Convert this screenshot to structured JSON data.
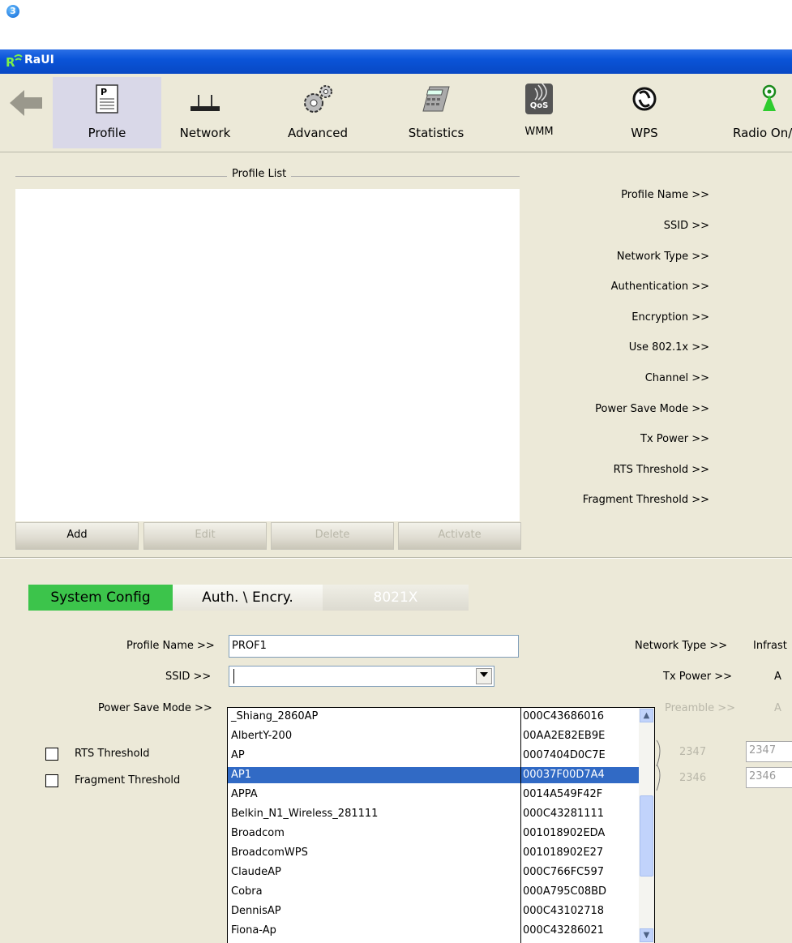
{
  "step_badge": "3",
  "window": {
    "title": "RaUI"
  },
  "toolbar": {
    "items": [
      {
        "label": "Profile",
        "icon": "profile-icon"
      },
      {
        "label": "Network",
        "icon": "network-icon"
      },
      {
        "label": "Advanced",
        "icon": "advanced-icon"
      },
      {
        "label": "Statistics",
        "icon": "statistics-icon"
      },
      {
        "label": "WMM",
        "icon": "wmm-icon"
      },
      {
        "label": "WPS",
        "icon": "wps-icon"
      },
      {
        "label": "Radio On/",
        "icon": "radio-icon"
      }
    ],
    "wmm_badge": "QoS"
  },
  "profile_list": {
    "title": "Profile List",
    "buttons": {
      "add": "Add",
      "edit": "Edit",
      "delete": "Delete",
      "activate": "Activate"
    }
  },
  "details": {
    "labels": [
      "Profile Name >>",
      "SSID >>",
      "Network Type >>",
      "Authentication >>",
      "Encryption >>",
      "Use 802.1x >>",
      "Channel >>",
      "Power Save Mode >>",
      "Tx Power >>",
      "RTS Threshold >>",
      "Fragment Threshold >>"
    ]
  },
  "tabs": {
    "system_config": "System Config",
    "auth_encry": "Auth. \\ Encry.",
    "x8021": "8021X"
  },
  "form": {
    "profile_name_label": "Profile Name >>",
    "profile_name_value": "PROF1",
    "ssid_label": "SSID >>",
    "power_save_label": "Power Save Mode >>",
    "network_type_label": "Network Type >>",
    "network_type_value": "Infrast",
    "tx_power_label": "Tx Power >>",
    "tx_power_value": "A",
    "preamble_label": "Preamble >>",
    "preamble_value": "A",
    "rts_label": "RTS Threshold",
    "rts_value": "2347",
    "rts_input": "2347",
    "frag_label": "Fragment Threshold",
    "frag_value": "2346",
    "frag_input": "2346"
  },
  "ssid_dropdown": {
    "selected_index": 3,
    "rows": [
      {
        "ssid": "_Shiang_2860AP",
        "bssid": "000C43686016"
      },
      {
        "ssid": "AlbertY-200",
        "bssid": "00AA2E82EB9E"
      },
      {
        "ssid": "AP",
        "bssid": "0007404D0C7E"
      },
      {
        "ssid": "AP1",
        "bssid": "00037F00D7A4"
      },
      {
        "ssid": "APPA",
        "bssid": "0014A549F42F"
      },
      {
        "ssid": "Belkin_N1_Wireless_281111",
        "bssid": "000C43281111"
      },
      {
        "ssid": "Broadcom",
        "bssid": "001018902EDA"
      },
      {
        "ssid": "BroadcomWPS",
        "bssid": "001018902E27"
      },
      {
        "ssid": "ClaudeAP",
        "bssid": "000C766FC597"
      },
      {
        "ssid": "Cobra",
        "bssid": "000A795C08BD"
      },
      {
        "ssid": "DennisAP",
        "bssid": "000C43102718"
      },
      {
        "ssid": "Fiona-Ap",
        "bssid": "000C43286021"
      }
    ]
  },
  "colors": {
    "titlebar": "#0a54d8",
    "active_tab": "#3cc44b",
    "selection": "#316ac5",
    "window_bg": "#ece9d8"
  }
}
